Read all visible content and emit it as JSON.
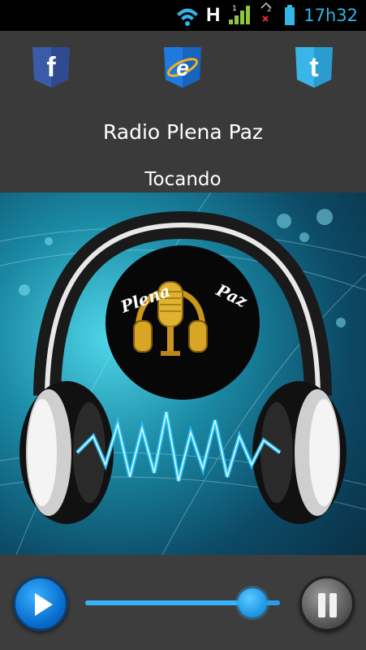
{
  "status_bar": {
    "network_label": "H",
    "clock": "17h32",
    "icons": [
      "wifi-icon",
      "signal-icon",
      "no-sim-icon",
      "battery-icon"
    ]
  },
  "social": {
    "facebook_label": "f",
    "ie_label": "e",
    "twitter_label": "t"
  },
  "player": {
    "station_name": "Radio Plena Paz",
    "status_text": "Tocando"
  },
  "artwork": {
    "logo_text_left": "Plena",
    "logo_text_right": "Paz"
  },
  "controls": {
    "volume_fraction": 0.86
  },
  "colors": {
    "accent": "#33b5e5",
    "background": "#3a3a3a",
    "statusbar": "#000000"
  }
}
